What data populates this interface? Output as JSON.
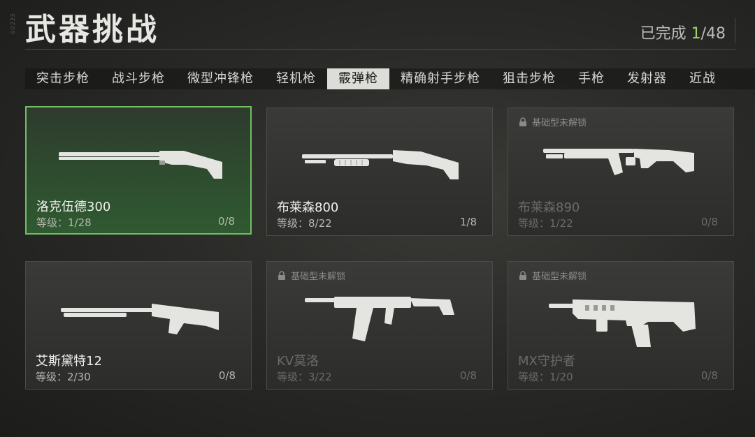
{
  "side_tag": "60225",
  "header": {
    "title": "武器挑战",
    "progress_label": "已完成 ",
    "progress_done": "1",
    "progress_total": "/48"
  },
  "tabs": [
    {
      "label": "突击步枪"
    },
    {
      "label": "战斗步枪"
    },
    {
      "label": "微型冲锋枪"
    },
    {
      "label": "轻机枪"
    },
    {
      "label": "霰弹枪",
      "active": true
    },
    {
      "label": "精确射手步枪"
    },
    {
      "label": "狙击步枪"
    },
    {
      "label": "手枪"
    },
    {
      "label": "发射器"
    },
    {
      "label": "近战"
    }
  ],
  "cards": [
    {
      "name": "洛克伍德300",
      "level": "等级：1/28",
      "count": "0/8",
      "selected": true,
      "locked": false,
      "icon": "lockwood-300-shotgun-icon"
    },
    {
      "name": "布莱森800",
      "level": "等级：8/22",
      "count": "1/8",
      "selected": false,
      "locked": false,
      "icon": "bryson-800-shotgun-icon"
    },
    {
      "name": "布莱森890",
      "level": "等级：1/22",
      "count": "0/8",
      "selected": false,
      "locked": true,
      "lock_text": "基础型未解锁",
      "icon": "bryson-890-shotgun-icon"
    },
    {
      "name": "艾斯黛特12",
      "level": "等级：2/30",
      "count": "0/8",
      "selected": false,
      "locked": false,
      "icon": "expedite-12-shotgun-icon"
    },
    {
      "name": "KV莫洛",
      "level": "等级：3/22",
      "count": "0/8",
      "selected": false,
      "locked": true,
      "lock_text": "基础型未解锁",
      "icon": "kv-broadside-shotgun-icon"
    },
    {
      "name": "MX守护者",
      "level": "等级：1/20",
      "count": "0/8",
      "selected": false,
      "locked": true,
      "lock_text": "基础型未解锁",
      "icon": "mx-guardian-shotgun-icon"
    }
  ],
  "colors": {
    "accent_green": "#6fbf62",
    "progress_green": "#9fd36a"
  }
}
